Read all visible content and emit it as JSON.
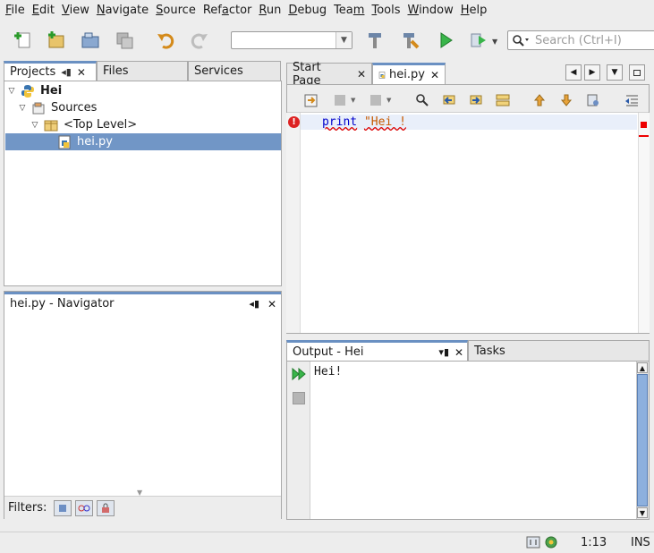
{
  "menu": [
    {
      "pre": "",
      "mn": "F",
      "post": "ile"
    },
    {
      "pre": "",
      "mn": "E",
      "post": "dit"
    },
    {
      "pre": "",
      "mn": "V",
      "post": "iew"
    },
    {
      "pre": "",
      "mn": "N",
      "post": "avigate"
    },
    {
      "pre": "",
      "mn": "S",
      "post": "ource"
    },
    {
      "pre": "Ref",
      "mn": "a",
      "post": "ctor"
    },
    {
      "pre": "",
      "mn": "R",
      "post": "un"
    },
    {
      "pre": "",
      "mn": "D",
      "post": "ebug"
    },
    {
      "pre": "Tea",
      "mn": "m",
      "post": ""
    },
    {
      "pre": "",
      "mn": "T",
      "post": "ools"
    },
    {
      "pre": "",
      "mn": "W",
      "post": "indow"
    },
    {
      "pre": "",
      "mn": "H",
      "post": "elp"
    }
  ],
  "toolbar": {
    "config_value": "",
    "search_placeholder": "Search (Ctrl+I)"
  },
  "left_tabs": {
    "projects": "Projects",
    "files": "Files",
    "services": "Services"
  },
  "tree": {
    "project": "Hei",
    "sources": "Sources",
    "top_level": "<Top Level>",
    "file": "hei.py"
  },
  "navigator": {
    "title": "hei.py - Navigator",
    "filters_label": "Filters:"
  },
  "editor_tabs": {
    "start_page": "Start Page",
    "file": "hei.py"
  },
  "editor": {
    "code_keyword": "print",
    "code_string": "\"Hei !"
  },
  "output": {
    "title": "Output - Hei",
    "tasks_tab": "Tasks",
    "text": "Hei!"
  },
  "status": {
    "position": "1:13",
    "mode": "INS"
  },
  "colors": {
    "selection": "#7196c6",
    "active_tab_accent": "#6a90c2",
    "error": "#d00000"
  }
}
